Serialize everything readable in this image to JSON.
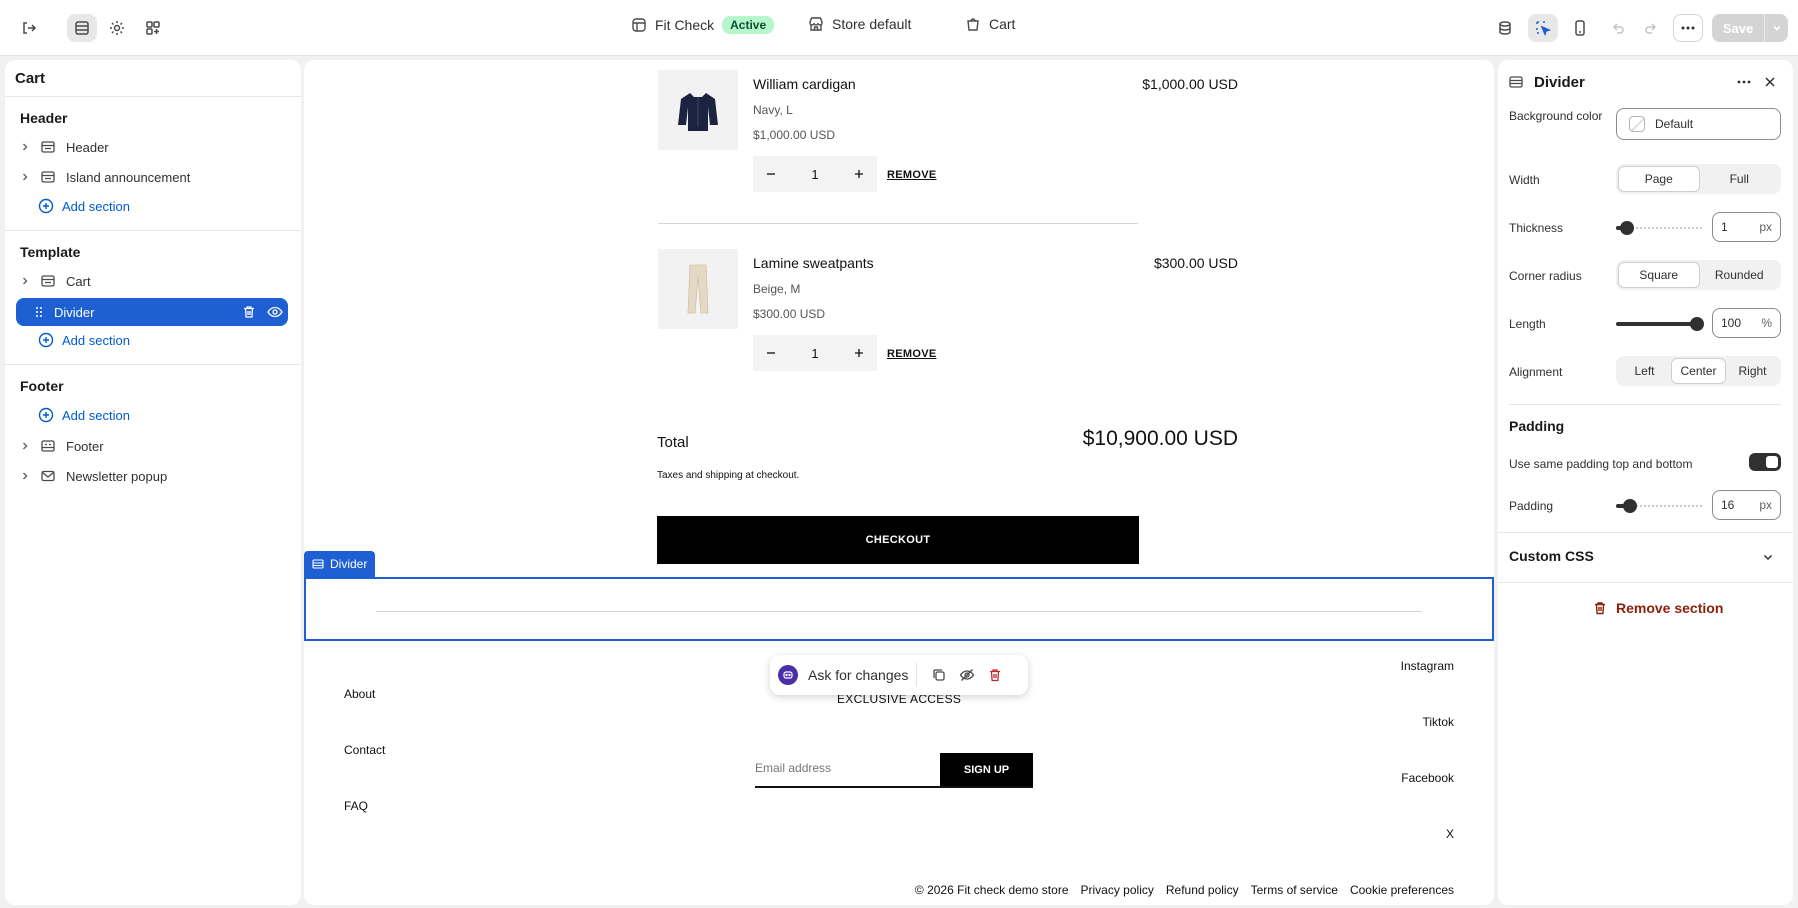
{
  "topbar": {
    "theme_name": "Fit Check",
    "theme_status": "Active",
    "store_label": "Store default",
    "page_label": "Cart",
    "save_label": "Save"
  },
  "left_panel": {
    "title": "Cart",
    "groups": [
      {
        "title": "Header",
        "items": [
          "Header",
          "Island announcement"
        ],
        "add_label": "Add section"
      },
      {
        "title": "Template",
        "items": [
          "Cart",
          "Divider"
        ],
        "add_label": "Add section"
      },
      {
        "title": "Footer",
        "items": [
          "Footer",
          "Newsletter popup"
        ],
        "add_label": "Add section"
      }
    ]
  },
  "cart": {
    "items": [
      {
        "name": "William cardigan",
        "variant": "Navy, L",
        "unit_price": "$1,000.00 USD",
        "price": "$1,000.00 USD",
        "qty": "1",
        "remove": "REMOVE"
      },
      {
        "name": "Lamine sweatpants",
        "variant": "Beige, M",
        "unit_price": "$300.00 USD",
        "price": "$300.00 USD",
        "qty": "1",
        "remove": "REMOVE"
      }
    ],
    "total_label": "Total",
    "total_value": "$10,900.00 USD",
    "tax_note": "Taxes and shipping at checkout.",
    "checkout_label": "CHECKOUT"
  },
  "divider_tag": "Divider",
  "footer": {
    "links": [
      "About",
      "Contact",
      "FAQ"
    ],
    "newsletter_heading": "EXCLUSIVE ACCESS",
    "email_placeholder": "Email address",
    "signup_label": "SIGN UP",
    "socials": [
      "Instagram",
      "Tiktok",
      "Facebook",
      "X"
    ],
    "copyright": "© 2026 Fit check demo store",
    "policies": [
      "Privacy policy",
      "Refund policy",
      "Terms of service",
      "Cookie preferences"
    ]
  },
  "ask_toolbar": {
    "label": "Ask for changes"
  },
  "right_panel": {
    "title": "Divider",
    "background_color_label": "Background color",
    "background_color_value": "Default",
    "width_label": "Width",
    "width_options": [
      "Page",
      "Full"
    ],
    "width_selected": "Page",
    "thickness_label": "Thickness",
    "thickness_value": "1",
    "thickness_unit": "px",
    "thickness_level": 0.05,
    "corner_radius_label": "Corner radius",
    "corner_radius_options": [
      "Square",
      "Rounded"
    ],
    "corner_radius_selected": "Square",
    "length_label": "Length",
    "length_value": "100",
    "length_unit": "%",
    "length_level": 1.0,
    "alignment_label": "Alignment",
    "alignment_options": [
      "Left",
      "Center",
      "Right"
    ],
    "alignment_selected": "Center",
    "padding_section": "Padding",
    "same_padding_label": "Use same padding top and bottom",
    "same_padding_on": true,
    "padding_label": "Padding",
    "padding_value": "16",
    "padding_unit": "px",
    "padding_level": 0.1,
    "custom_css_label": "Custom CSS",
    "remove_section_label": "Remove section"
  }
}
